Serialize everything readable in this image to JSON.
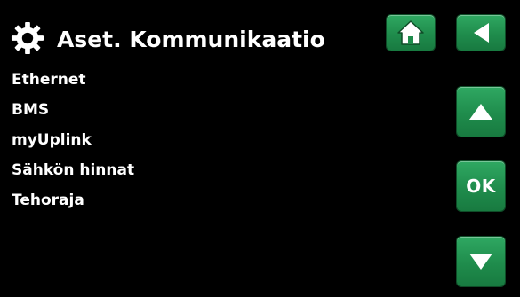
{
  "header": {
    "title": "Aset. Kommunikaatio",
    "title_icon": "gear-icon"
  },
  "menu": {
    "items": [
      {
        "label": "Ethernet"
      },
      {
        "label": "BMS"
      },
      {
        "label": "myUplink"
      },
      {
        "label": "Sähkön hinnat"
      },
      {
        "label": "Tehoraja"
      }
    ]
  },
  "buttons": {
    "home_icon": "home-icon",
    "back_icon": "back-arrow-icon",
    "up_icon": "up-arrow-icon",
    "ok_label": "OK",
    "down_icon": "down-arrow-icon"
  },
  "colors": {
    "background": "#000000",
    "button_green": "#1f8c4c",
    "text": "#ffffff"
  }
}
